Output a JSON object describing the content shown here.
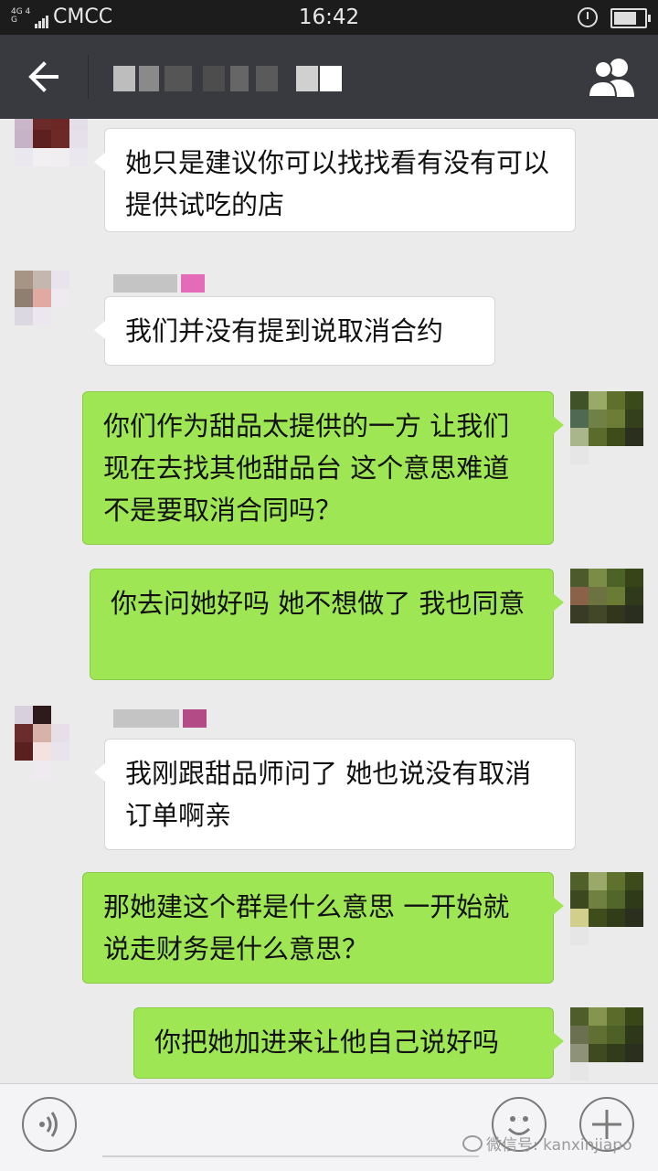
{
  "status_bar": {
    "network": "4G 4G",
    "carrier": "CMCC",
    "time": "16:42",
    "battery_level": 0.75,
    "icons": [
      "signal-icon",
      "alarm-icon",
      "battery-icon"
    ]
  },
  "header": {
    "icons": {
      "back": "arrow-left-icon",
      "group": "group-members-icon"
    }
  },
  "messages": [
    {
      "direction": "in",
      "text": "她只是建议你可以找找看有没有可以提供试吃的店"
    },
    {
      "direction": "in",
      "text": "我们并没有提到说取消合约"
    },
    {
      "direction": "out",
      "text": "你们作为甜品太提供的一方 让我们现在去找其他甜品台 这个意思难道不是要取消合同吗？"
    },
    {
      "direction": "out",
      "text": "你去问她好吗 她不想做了 我也同意"
    },
    {
      "direction": "in",
      "text": "我刚跟甜品师问了 她也说没有取消订单啊亲"
    },
    {
      "direction": "out",
      "text": "那她建这个群是什么意思 一开始就说走财务是什么意思？"
    },
    {
      "direction": "out",
      "text": "你把她加进来让他自己说好吗"
    }
  ],
  "bottom_bar": {
    "watermark": "微信号: kanxinjiapo",
    "icons": {
      "voice": "voice-icon",
      "emoji": "emoji-icon",
      "more": "plus-icon"
    }
  },
  "colors": {
    "header_bg": "#393a3f",
    "chat_bg": "#ebebeb",
    "outgoing_bubble": "#9ee654",
    "incoming_bubble": "#ffffff"
  }
}
